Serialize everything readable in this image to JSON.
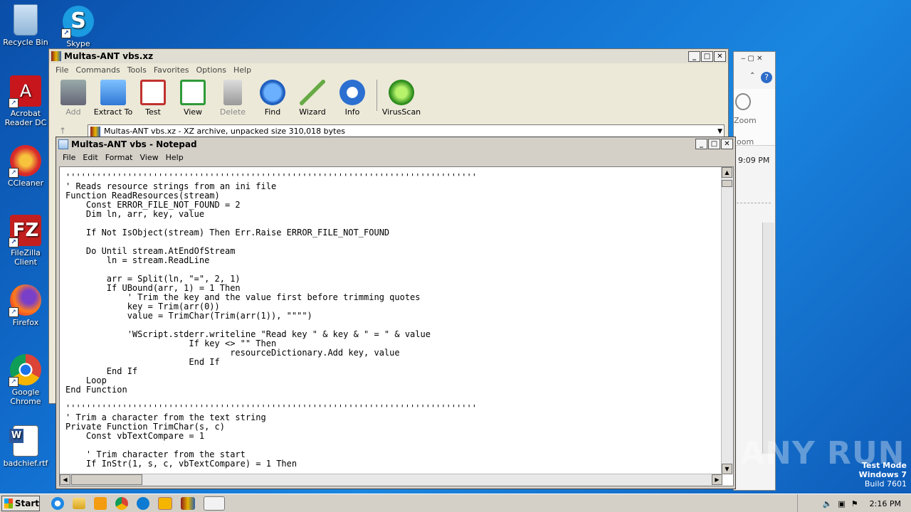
{
  "desktop": {
    "icons": [
      {
        "label": "Recycle Bin"
      },
      {
        "label": "Skype"
      },
      {
        "label": "Acrobat Reader DC"
      },
      {
        "label": "CCleaner"
      },
      {
        "label": "FileZilla Client"
      },
      {
        "label": "Firefox"
      },
      {
        "label": "Google Chrome"
      },
      {
        "label": "badchief.rtf"
      }
    ]
  },
  "archiver": {
    "title": "Multas-ANT vbs.xz",
    "menu": [
      "File",
      "Commands",
      "Tools",
      "Favorites",
      "Options",
      "Help"
    ],
    "tools": [
      "Add",
      "Extract To",
      "Test",
      "View",
      "Delete",
      "Find",
      "Wizard",
      "Info",
      "VirusScan"
    ],
    "address": "Multas-ANT vbs.xz - XZ archive, unpacked size 310,018 bytes"
  },
  "notepad": {
    "title": "Multas-ANT vbs - Notepad",
    "menu": [
      "File",
      "Edit",
      "Format",
      "View",
      "Help"
    ],
    "content": "''''''''''''''''''''''''''''''''''''''''''''''''''''''''''''''''''''''''''''''''\n' Reads resource strings from an ini file\nFunction ReadResources(stream)\n    Const ERROR_FILE_NOT_FOUND = 2\n    Dim ln, arr, key, value\n\n    If Not IsObject(stream) Then Err.Raise ERROR_FILE_NOT_FOUND\n\n    Do Until stream.AtEndOfStream\n        ln = stream.ReadLine\n\n        arr = Split(ln, \"=\", 2, 1)\n        If UBound(arr, 1) = 1 Then\n            ' Trim the key and the value first before trimming quotes\n            key = Trim(arr(0))\n            value = TrimChar(Trim(arr(1)), \"\"\"\")\n\n            'WScript.stderr.writeline \"Read key \" & key & \" = \" & value\n                        If key <> \"\" Then\n                                resourceDictionary.Add key, value\n                        End If\n        End If\n    Loop\nEnd Function\n\n''''''''''''''''''''''''''''''''''''''''''''''''''''''''''''''''''''''''''''''''\n' Trim a character from the text string\nPrivate Function TrimChar(s, c)\n    Const vbTextCompare = 1\n\n    ' Trim character from the start\n    If InStr(1, s, c, vbTextCompare) = 1 Then"
  },
  "side_window": {
    "zoom_label": "Zoom",
    "zoom_label2": "oom",
    "time_text": "9:09 PM"
  },
  "taskbar": {
    "start_label": "Start",
    "clock": "2:16 PM"
  },
  "watermark": {
    "line1": "Test Mode",
    "line2": "Windows 7",
    "line3": "Build 7601",
    "brand": "ANY RUN"
  }
}
